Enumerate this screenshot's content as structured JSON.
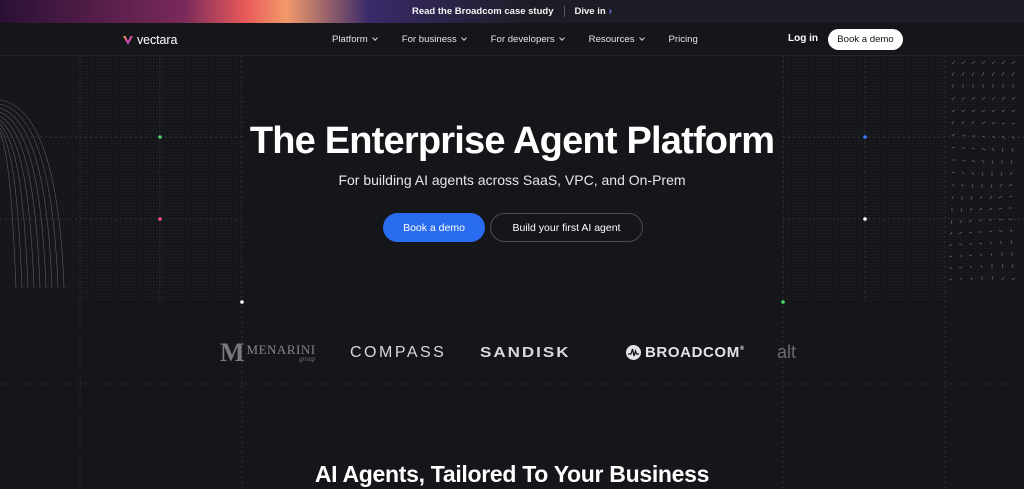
{
  "announcement": {
    "text": "Read the Broadcom case study",
    "link_label": "Dive in",
    "link_icon": "chevron-right-icon"
  },
  "nav": {
    "brand": "vectara",
    "brand_icon": "vectara-logo-icon",
    "menu": [
      {
        "label": "Platform",
        "has_dropdown": true
      },
      {
        "label": "For business",
        "has_dropdown": true
      },
      {
        "label": "For developers",
        "has_dropdown": true
      },
      {
        "label": "Resources",
        "has_dropdown": true
      },
      {
        "label": "Pricing",
        "has_dropdown": false
      }
    ],
    "login_label": "Log in",
    "demo_label": "Book a demo"
  },
  "hero": {
    "title": "The Enterprise Agent Platform",
    "subtitle": "For building AI agents across SaaS, VPC, and On-Prem",
    "primary_cta": "Book a demo",
    "secondary_cta": "Build your first AI agent"
  },
  "customer_logos": {
    "menarini": {
      "name": "MENARINI",
      "suffix": "group"
    },
    "compass": "COMPASS",
    "sandisk": "SANDISK",
    "broadcom": "BROADCOM",
    "broadcom_mark": "®",
    "partial": "alt"
  },
  "section": {
    "title": "AI Agents, Tailored To Your Business"
  },
  "colors": {
    "background": "#15161a",
    "accent": "#2a6cf0",
    "text": "#ffffff"
  }
}
